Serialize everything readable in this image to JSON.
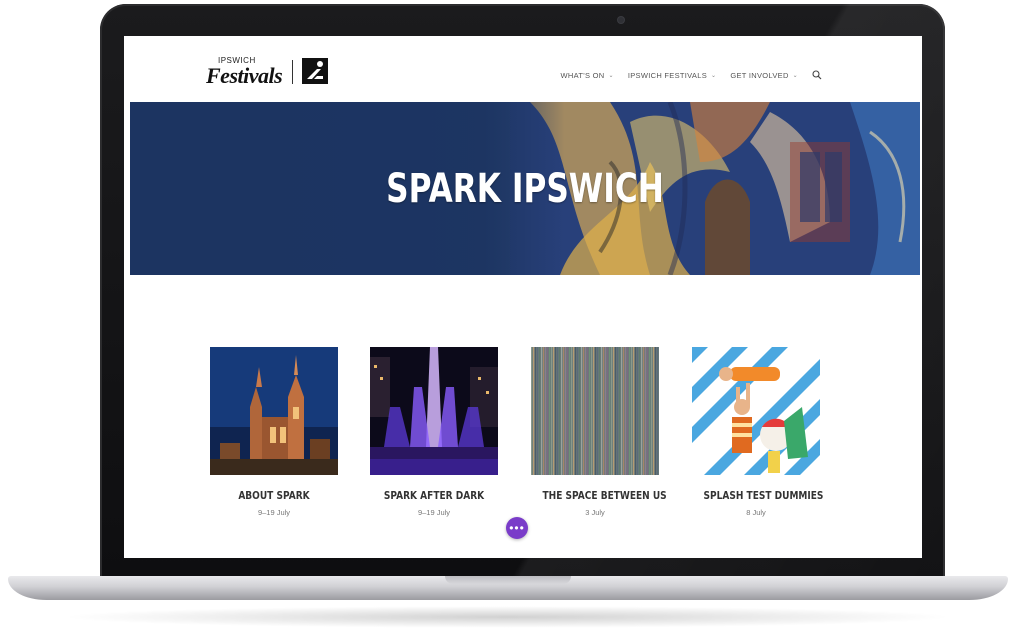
{
  "site": {
    "logo_top": "IPSWICH",
    "logo_script": "Festivals"
  },
  "nav": {
    "items": [
      {
        "label": "WHAT'S ON"
      },
      {
        "label": "IPSWICH FESTIVALS"
      },
      {
        "label": "GET INVOLVED"
      }
    ],
    "chevron": "⌄",
    "search_icon": "search-icon"
  },
  "hero": {
    "title": "SPARK IPSWICH"
  },
  "cards": [
    {
      "title": "ABOUT SPARK",
      "date": "9–19 July"
    },
    {
      "title": "SPARK AFTER DARK",
      "date": "9–19 July"
    },
    {
      "title": "THE SPACE BETWEEN US",
      "date": "3 July"
    },
    {
      "title": "SPLASH TEST DUMMIES",
      "date": "8 July"
    }
  ],
  "fab": {
    "label": "•••"
  },
  "colors": {
    "hero_blue": "#1d3a6c",
    "fab_purple": "#7a3cc9"
  }
}
